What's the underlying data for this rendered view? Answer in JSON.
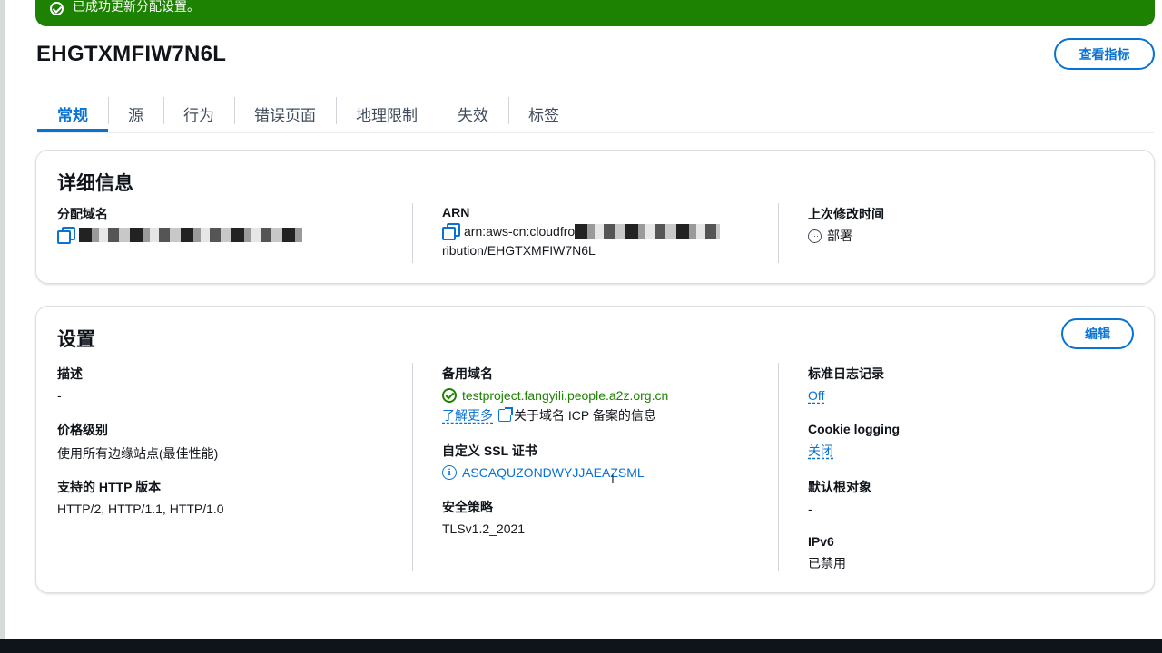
{
  "flash": {
    "message": "已成功更新分配设置。"
  },
  "header": {
    "title": "EHGTXMFIW7N6L",
    "metrics_button": "查看指标"
  },
  "tabs": [
    {
      "label": "常规",
      "active": true
    },
    {
      "label": "源"
    },
    {
      "label": "行为"
    },
    {
      "label": "错误页面"
    },
    {
      "label": "地理限制"
    },
    {
      "label": "失效"
    },
    {
      "label": "标签"
    }
  ],
  "details": {
    "title": "详细信息",
    "domain_label": "分配域名",
    "arn_label": "ARN",
    "arn_prefix": "arn:aws-cn:cloudfro",
    "arn_suffix": "ribution/EHGTXMFIW7N6L",
    "modified_label": "上次修改时间",
    "modified_value": "部署"
  },
  "settings": {
    "title": "设置",
    "edit_button": "编辑",
    "description_label": "描述",
    "description_value": "-",
    "price_label": "价格级别",
    "price_value": "使用所有边缘站点(最佳性能)",
    "http_label": "支持的 HTTP 版本",
    "http_value": "HTTP/2, HTTP/1.1, HTTP/1.0",
    "alt_domain_label": "备用域名",
    "alt_domain_value": "testproject.fangyili.people.a2z.org.cn",
    "learn_more": "了解更多",
    "icp_text": "关于域名 ICP 备案的信息",
    "ssl_label": "自定义 SSL 证书",
    "ssl_value": "ASCAQUZONDWYJJAEAZSML",
    "security_label": "安全策略",
    "security_value": "TLSv1.2_2021",
    "logging_label": "标准日志记录",
    "logging_value": "Off",
    "cookie_label": "Cookie logging",
    "cookie_value": "关闭",
    "root_label": "默认根对象",
    "root_value": "-",
    "ipv6_label": "IPv6",
    "ipv6_value": "已禁用"
  },
  "colors": {
    "accent": "#0972d3",
    "success": "#1d8102",
    "text": "#16191f"
  }
}
